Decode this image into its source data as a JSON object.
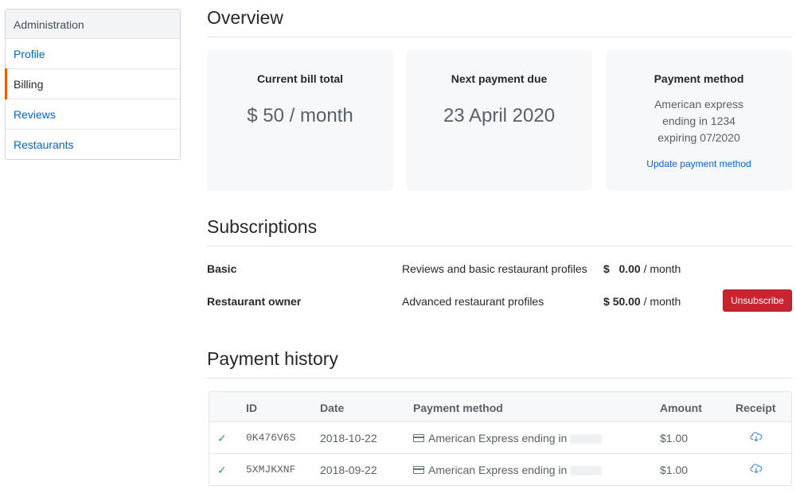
{
  "sidebar": {
    "heading": "Administration",
    "items": [
      {
        "label": "Profile"
      },
      {
        "label": "Billing"
      },
      {
        "label": "Reviews"
      },
      {
        "label": "Restaurants"
      }
    ],
    "active": "Billing",
    "accent_color": "#e36209"
  },
  "overview": {
    "title": "Overview",
    "cards": [
      {
        "title": "Current bill total",
        "value": "$ 50 / month"
      },
      {
        "title": "Next payment due",
        "value": "23 April 2020"
      },
      {
        "title": "Payment method",
        "lines": [
          "American express",
          "ending in 1234",
          "expiring 07/2020"
        ],
        "link": "Update payment method"
      }
    ]
  },
  "subscriptions": {
    "title": "Subscriptions",
    "rows": [
      {
        "name": "Basic",
        "description": "Reviews and basic restaurant profiles",
        "currency": "$",
        "amount": "0.00",
        "period": "/ month"
      },
      {
        "name": "Restaurant owner",
        "description": "Advanced restaurant profiles",
        "currency": "$",
        "amount": "50.00",
        "period": "/ month",
        "action": "Unsubscribe"
      }
    ],
    "danger_color": "#cb2431"
  },
  "history": {
    "title": "Payment history",
    "columns": [
      "ID",
      "Date",
      "Payment method",
      "Amount",
      "Receipt"
    ],
    "rows": [
      {
        "status": "✓",
        "id": "0K476V6S",
        "date": "2018-10-22",
        "method": "American Express ending in",
        "amount": "$1.00"
      },
      {
        "status": "✓",
        "id": "5XMJKXNF",
        "date": "2018-09-22",
        "method": "American Express ending in",
        "amount": "$1.00"
      }
    ],
    "success_color": "#28a745",
    "receipt_icon": "cloud-download-icon"
  }
}
